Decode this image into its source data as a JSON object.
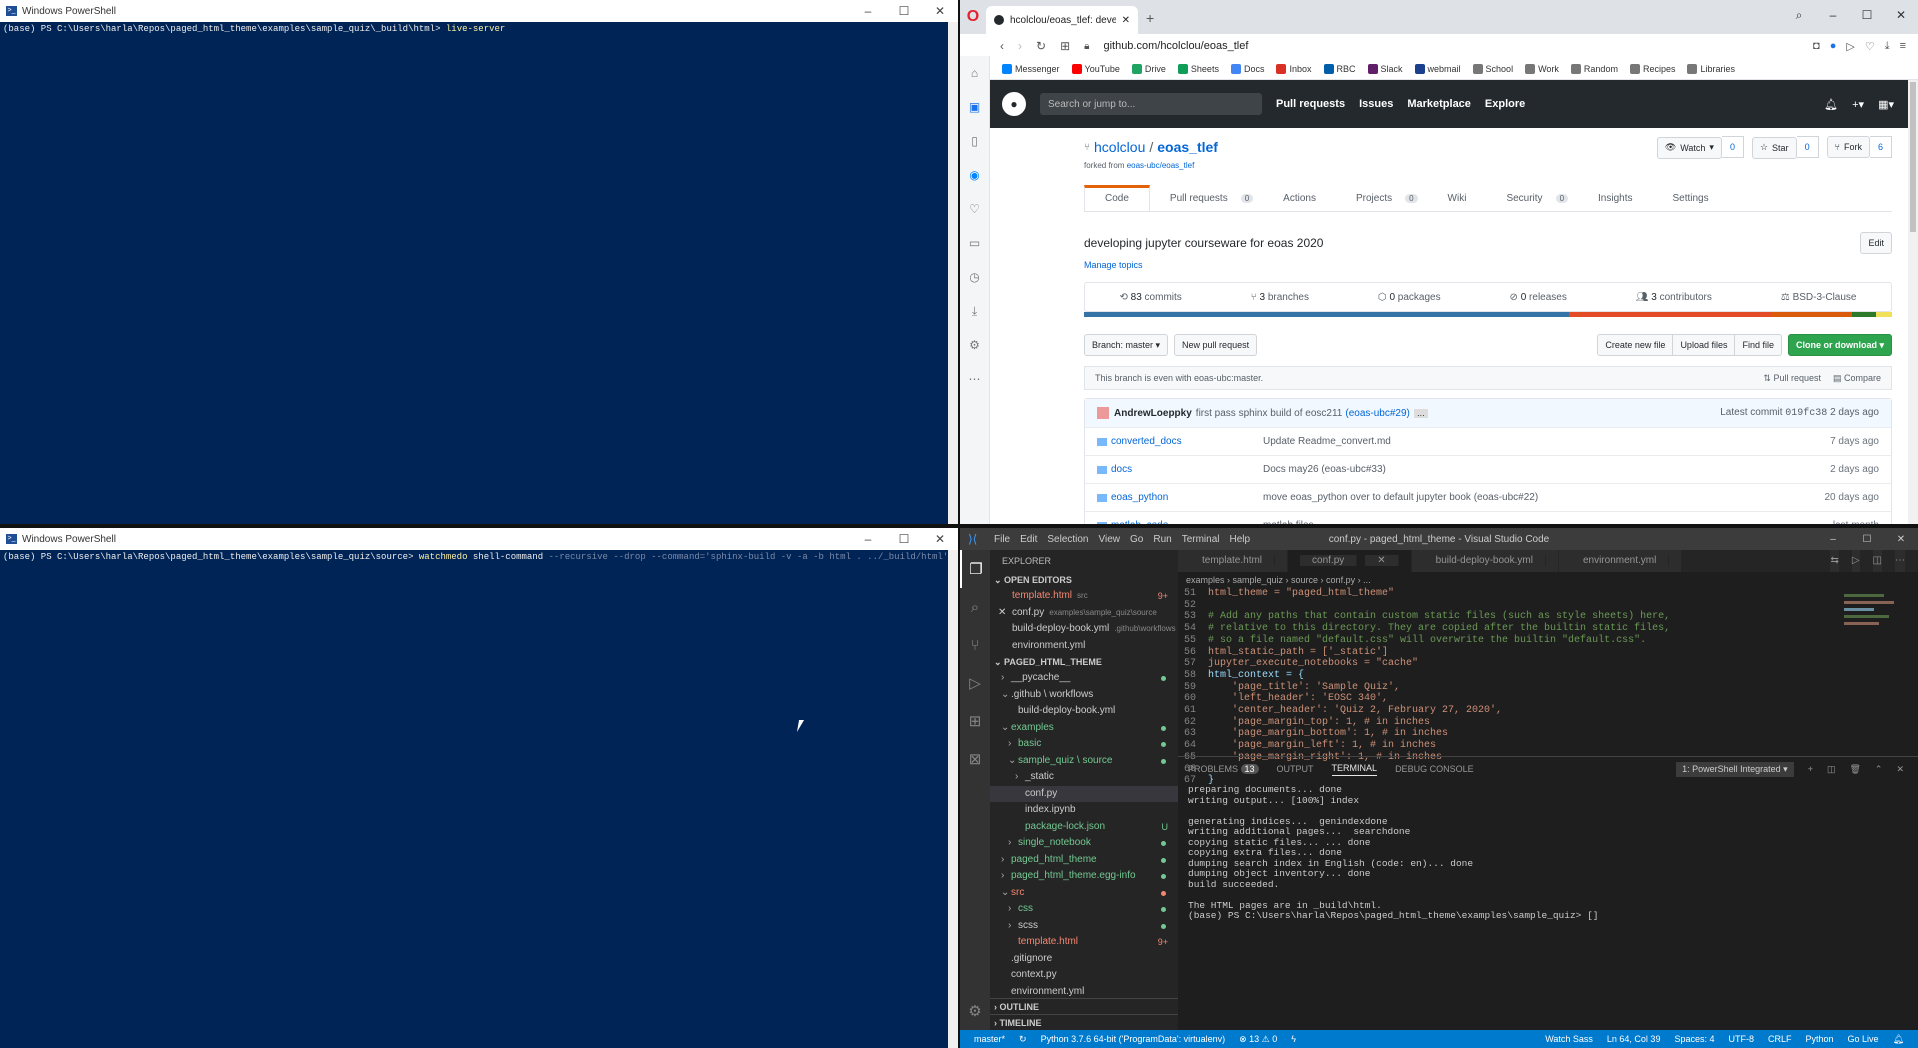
{
  "ps1": {
    "title": "Windows PowerShell",
    "prompt": "(base) PS C:\\Users\\harla\\Repos\\paged_html_theme\\examples\\sample_quiz\\_build\\html>",
    "command": "live-server"
  },
  "ps2": {
    "title": "Windows PowerShell",
    "prompt": "(base) PS C:\\Users\\harla\\Repos\\paged_html_theme\\examples\\sample_quiz\\source>",
    "command": "watchmedo",
    "args1": "shell-command",
    "args2": "--recursive --drop --command='sphinx-build -v -a -b html . ../_build/html' ."
  },
  "browser": {
    "tab_title": "hcolclou/eoas_tlef: develop",
    "url": "github.com/hcolclou/eoas_tlef",
    "bookmarks": [
      "Messenger",
      "YouTube",
      "Drive",
      "Sheets",
      "Docs",
      "Inbox",
      "RBC",
      "Slack",
      "webmail",
      "School",
      "Work",
      "Random",
      "Recipes",
      "Libraries"
    ],
    "bookmark_colors": [
      "#0084ff",
      "#ff0000",
      "#1fa463",
      "#0f9d58",
      "#4285f4",
      "#d93025",
      "#005daa",
      "#611f69",
      "#1a3f8c",
      "#777",
      "#777",
      "#777",
      "#777",
      "#777"
    ]
  },
  "github": {
    "search_placeholder": "Search or jump to...",
    "nav": [
      "Pull requests",
      "Issues",
      "Marketplace",
      "Explore"
    ],
    "owner": "hcolclou",
    "sep": "/",
    "repo": "eoas_tlef",
    "forked_label": "forked from",
    "forked_from": "eoas-ubc/eoas_tlef",
    "watch": "Watch",
    "watch_count": "0",
    "star": "Star",
    "star_count": "0",
    "fork": "Fork",
    "fork_count": "6",
    "tabs": [
      {
        "label": "Code",
        "count": ""
      },
      {
        "label": "Pull requests",
        "count": "0"
      },
      {
        "label": "Actions",
        "count": ""
      },
      {
        "label": "Projects",
        "count": "0"
      },
      {
        "label": "Wiki",
        "count": ""
      },
      {
        "label": "Security",
        "count": "0"
      },
      {
        "label": "Insights",
        "count": ""
      },
      {
        "label": "Settings",
        "count": ""
      }
    ],
    "description": "developing jupyter courseware for eoas 2020",
    "edit": "Edit",
    "manage_topics": "Manage topics",
    "commits": "83",
    "commits_label": "commits",
    "branches": "3",
    "branches_label": "branches",
    "packages": "0",
    "packages_label": "packages",
    "releases": "0",
    "releases_label": "releases",
    "contributors": "3",
    "contributors_label": "contributors",
    "license": "BSD-3-Clause",
    "branch_btn": "Branch: master ▾",
    "new_pr": "New pull request",
    "create_file": "Create new file",
    "upload": "Upload files",
    "find": "Find file",
    "clone": "Clone or download ▾",
    "even_msg": "This branch is even with eoas-ubc:master.",
    "pull_request": "Pull request",
    "compare": "Compare",
    "commit_author": "AndrewLoeppky",
    "commit_msg": "first pass sphinx build of eosc211",
    "commit_ref": "(eoas-ubc#29)",
    "latest_commit": "Latest commit",
    "commit_hash": "019fc38",
    "commit_age": "2 days ago",
    "files": [
      {
        "name": "converted_docs",
        "msg": "Update Readme_convert.md",
        "age": "7 days ago"
      },
      {
        "name": "docs",
        "msg": "Docs may26 (eoas-ubc#33)",
        "age": "2 days ago"
      },
      {
        "name": "eoas_python",
        "msg": "move eoas_python over to default jupyter book (eoas-ubc#22)",
        "age": "20 days ago"
      },
      {
        "name": "matlab_code",
        "msg": "matlab files",
        "age": "last month"
      }
    ]
  },
  "vscode": {
    "menu": [
      "File",
      "Edit",
      "Selection",
      "View",
      "Go",
      "Run",
      "Terminal",
      "Help"
    ],
    "title": "conf.py - paged_html_theme - Visual Studio Code",
    "explorer": "EXPLORER",
    "open_editors": "OPEN EDITORS",
    "open_files": [
      {
        "name": "template.html",
        "path": "src",
        "badge": "9+"
      },
      {
        "name": "conf.py",
        "path": "examples\\sample_quiz\\source",
        "badge": ""
      },
      {
        "name": "build-deploy-book.yml",
        "path": ".github\\workflows",
        "badge": ""
      },
      {
        "name": "environment.yml",
        "path": "",
        "badge": ""
      }
    ],
    "project": "PAGED_HTML_THEME",
    "tree": [
      {
        "label": "__pycache__",
        "indent": 1,
        "arrow": "›",
        "color": "",
        "mark": "dot"
      },
      {
        "label": ".github \\ workflows",
        "indent": 1,
        "arrow": "⌄",
        "color": "",
        "mark": ""
      },
      {
        "label": "build-deploy-book.yml",
        "indent": 2,
        "arrow": "",
        "color": "",
        "mark": ""
      },
      {
        "label": "examples",
        "indent": 1,
        "arrow": "⌄",
        "color": "grn",
        "mark": "dot"
      },
      {
        "label": "basic",
        "indent": 2,
        "arrow": "›",
        "color": "grn",
        "mark": "dot"
      },
      {
        "label": "sample_quiz \\ source",
        "indent": 2,
        "arrow": "⌄",
        "color": "grn",
        "mark": "dot"
      },
      {
        "label": "_static",
        "indent": 3,
        "arrow": "›",
        "color": "",
        "mark": ""
      },
      {
        "label": "conf.py",
        "indent": 3,
        "arrow": "",
        "color": "",
        "mark": "",
        "sel": true
      },
      {
        "label": "index.ipynb",
        "indent": 3,
        "arrow": "",
        "color": "",
        "mark": ""
      },
      {
        "label": "package-lock.json",
        "indent": 3,
        "arrow": "",
        "color": "grn",
        "mark": "U"
      },
      {
        "label": "single_notebook",
        "indent": 2,
        "arrow": "›",
        "color": "grn",
        "mark": "dot"
      },
      {
        "label": "paged_html_theme",
        "indent": 1,
        "arrow": "›",
        "color": "grn",
        "mark": "dot"
      },
      {
        "label": "paged_html_theme.egg-info",
        "indent": 1,
        "arrow": "›",
        "color": "grn",
        "mark": "dot"
      },
      {
        "label": "src",
        "indent": 1,
        "arrow": "⌄",
        "color": "red",
        "mark": "dot"
      },
      {
        "label": "css",
        "indent": 2,
        "arrow": "›",
        "color": "grn",
        "mark": "dot"
      },
      {
        "label": "scss",
        "indent": 2,
        "arrow": "›",
        "color": "",
        "mark": "dot"
      },
      {
        "label": "template.html",
        "indent": 2,
        "arrow": "",
        "color": "red",
        "mark": "9+"
      },
      {
        "label": ".gitignore",
        "indent": 1,
        "arrow": "",
        "color": "",
        "mark": ""
      },
      {
        "label": "context.py",
        "indent": 1,
        "arrow": "",
        "color": "",
        "mark": ""
      },
      {
        "label": "environment.yml",
        "indent": 1,
        "arrow": "",
        "color": "",
        "mark": ""
      }
    ],
    "outline": "OUTLINE",
    "timeline": "TIMELINE",
    "tabs": [
      "template.html",
      "conf.py",
      "build-deploy-book.yml",
      "environment.yml"
    ],
    "breadcrumb": "examples  ›  sample_quiz  ›  source  ›  conf.py  ›  ...",
    "code": [
      {
        "n": "51",
        "t": "html_theme = \"paged_html_theme\"",
        "k": "str"
      },
      {
        "n": "52",
        "t": "",
        "k": ""
      },
      {
        "n": "53",
        "t": "# Add any paths that contain custom static files (such as style sheets) here,",
        "k": "com"
      },
      {
        "n": "54",
        "t": "# relative to this directory. They are copied after the builtin static files,",
        "k": "com"
      },
      {
        "n": "55",
        "t": "# so a file named \"default.css\" will overwrite the builtin \"default.css\".",
        "k": "com"
      },
      {
        "n": "56",
        "t": "html_static_path = ['_static']",
        "k": "str"
      },
      {
        "n": "57",
        "t": "jupyter_execute_notebooks = \"cache\"",
        "k": "str"
      },
      {
        "n": "58",
        "t": "html_context = {",
        "k": ""
      },
      {
        "n": "59",
        "t": "    'page_title': 'Sample Quiz',",
        "k": "str"
      },
      {
        "n": "60",
        "t": "    'left_header': 'EOSC 340',",
        "k": "str"
      },
      {
        "n": "61",
        "t": "    'center_header': 'Quiz 2, February 27, 2020',",
        "k": "str"
      },
      {
        "n": "62",
        "t": "    'page_margin_top': 1, # in inches",
        "k": "str"
      },
      {
        "n": "63",
        "t": "    'page_margin_bottom': 1, # in inches",
        "k": "str"
      },
      {
        "n": "64",
        "t": "    'page_margin_left': 1, # in inches",
        "k": "str"
      },
      {
        "n": "65",
        "t": "    'page_margin_right': 1, # in inches",
        "k": "str"
      },
      {
        "n": "66",
        "t": "",
        "k": ""
      },
      {
        "n": "67",
        "t": "}",
        "k": ""
      }
    ],
    "panel_tabs": [
      "PROBLEMS",
      "OUTPUT",
      "TERMINAL",
      "DEBUG CONSOLE"
    ],
    "problems_count": "13",
    "terminal_select": "1: PowerShell Integrated ▾",
    "terminal_lines": [
      "preparing documents... done",
      "writing output... [100%] index",
      "",
      "generating indices...  genindexdone",
      "writing additional pages...  searchdone",
      "copying static files... ... done",
      "copying extra files... done",
      "dumping search index in English (code: en)... done",
      "dumping object inventory... done",
      "build succeeded.",
      "",
      "The HTML pages are in _build\\html.",
      "(base) PS C:\\Users\\harla\\Repos\\paged_html_theme\\examples\\sample_quiz> []"
    ],
    "status_left": [
      "master*",
      "Python 3.7.6 64-bit ('ProgramData': virtualenv)",
      "⊗ 13 ⚠ 0"
    ],
    "status_right": [
      "Watch Sass",
      "Ln 64, Col 39",
      "Spaces: 4",
      "UTF-8",
      "CRLF",
      "Python",
      "Go Live"
    ]
  }
}
